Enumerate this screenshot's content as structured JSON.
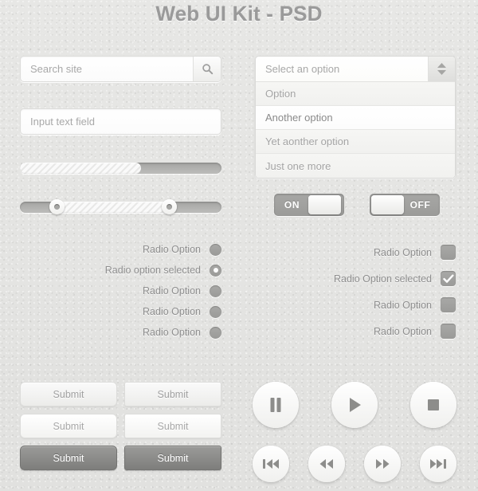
{
  "page": {
    "title": "Web UI Kit - PSD"
  },
  "search": {
    "placeholder": "Search site",
    "icon": "search-icon"
  },
  "text_input": {
    "placeholder": "Input text field"
  },
  "progress": {
    "value_percent": 60
  },
  "range_slider": {
    "low_percent": 18,
    "high_percent": 74
  },
  "radio_group": {
    "items": [
      {
        "label": "Radio Option",
        "selected": false
      },
      {
        "label": "Radio option selected",
        "selected": true
      },
      {
        "label": "Radio Option",
        "selected": false
      },
      {
        "label": "Radio Option",
        "selected": false
      },
      {
        "label": "Radio Option",
        "selected": false
      }
    ]
  },
  "select": {
    "placeholder": "Select an option",
    "stepper_icon": "updown-arrows-icon",
    "options": [
      {
        "label": "Option",
        "highlighted": false
      },
      {
        "label": "Another option",
        "highlighted": true
      },
      {
        "label": "Yet aonther option",
        "highlighted": false
      },
      {
        "label": "Just one more",
        "highlighted": false
      }
    ]
  },
  "toggles": [
    {
      "label": "ON",
      "state": "on"
    },
    {
      "label": "OFF",
      "state": "off"
    }
  ],
  "checkbox_group": {
    "items": [
      {
        "label": "Radio Option",
        "checked": false
      },
      {
        "label": "Radio Option selected",
        "checked": true
      },
      {
        "label": "Radio Option",
        "checked": false
      },
      {
        "label": "Radio Option",
        "checked": false
      }
    ]
  },
  "buttons": {
    "submit_label": "Submit",
    "grid": [
      {
        "label": "Submit",
        "style": "light",
        "corner": "round"
      },
      {
        "label": "Submit",
        "style": "light",
        "corner": "sharp"
      },
      {
        "label": "Submit",
        "style": "white",
        "corner": "round"
      },
      {
        "label": "Submit",
        "style": "white",
        "corner": "sharp"
      },
      {
        "label": "Submit",
        "style": "dark",
        "corner": "round"
      },
      {
        "label": "Submit",
        "style": "dark",
        "corner": "sharp"
      }
    ]
  },
  "media_controls": {
    "primary": [
      "pause-icon",
      "play-icon",
      "stop-icon"
    ],
    "secondary": [
      "skip-back-icon",
      "rewind-icon",
      "fast-forward-icon",
      "skip-forward-icon"
    ]
  },
  "colors": {
    "background": "#e5e5e3",
    "text_muted": "#a8a8a8",
    "text_label": "#8e8e8e",
    "title": "#9a9a9a",
    "control_gray": "#a0a09e",
    "dark_button": "#8a8a88"
  }
}
